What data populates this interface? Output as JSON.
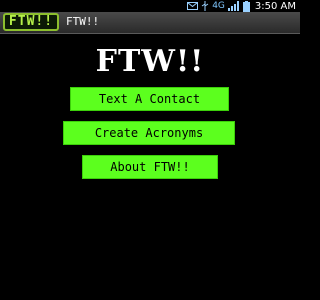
{
  "status_bar": {
    "network": "4G",
    "time": "3:50 AM",
    "icons": [
      "mail-icon",
      "usb-icon",
      "signal-icon",
      "battery-icon"
    ]
  },
  "title_bar": {
    "app_icon_text": "FTW!!",
    "title": "FTW!!"
  },
  "main": {
    "headline": "FTW!!",
    "buttons": [
      {
        "label": "Text A Contact"
      },
      {
        "label": "Create Acronyms"
      },
      {
        "label": "About FTW!!"
      }
    ]
  },
  "colors": {
    "background": "#000000",
    "button_green": "#5cff1e",
    "app_icon_green": "#b6f04a"
  }
}
